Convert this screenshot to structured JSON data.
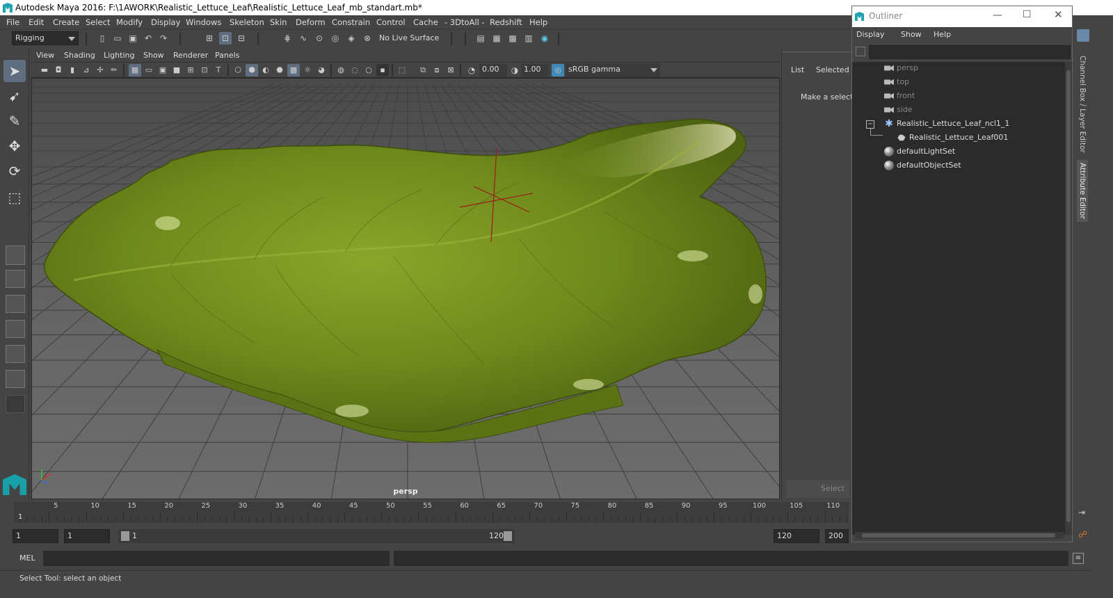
{
  "window": {
    "title": "Autodesk Maya 2016: F:\\1AWORK\\Realistic_Lettuce_Leaf\\Realistic_Lettuce_Leaf_mb_standart.mb*"
  },
  "menu": [
    "File",
    "Edit",
    "Create",
    "Select",
    "Modify",
    "Display",
    "Windows",
    "Skeleton",
    "Skin",
    "Deform",
    "Constrain",
    "Control",
    "Cache",
    "- 3DtoAll -",
    "Redshift",
    "Help"
  ],
  "shelf": {
    "mode": "Rigging",
    "live_surface": "No Live Surface"
  },
  "viewport": {
    "menu": [
      "View",
      "Shading",
      "Lighting",
      "Show",
      "Renderer",
      "Panels"
    ],
    "exposure": "0.00",
    "gamma": "1.00",
    "color_space": "sRGB gamma",
    "camera_label": "persp",
    "leaf_color": "#6f8a1c"
  },
  "channel_box": {
    "tabs": [
      "List",
      "Selected"
    ],
    "message": "Make a selecti",
    "select_btn": "Select"
  },
  "outliner": {
    "title": "Outliner",
    "menu": [
      "Display",
      "Show",
      "Help"
    ],
    "items": [
      {
        "label": "persp",
        "type": "camera"
      },
      {
        "label": "top",
        "type": "camera"
      },
      {
        "label": "front",
        "type": "camera"
      },
      {
        "label": "side",
        "type": "camera"
      },
      {
        "label": "Realistic_Lettuce_Leaf_ncl1_1",
        "type": "group"
      },
      {
        "label": "Realistic_Lettuce_Leaf001",
        "type": "mesh"
      },
      {
        "label": "defaultLightSet",
        "type": "set"
      },
      {
        "label": "defaultObjectSet",
        "type": "set"
      }
    ]
  },
  "side_tabs": [
    "Channel Box / Layer Editor",
    "Attribute Editor"
  ],
  "timeline": {
    "ticks": [
      "5",
      "10",
      "15",
      "20",
      "25",
      "30",
      "35",
      "40",
      "45",
      "50",
      "55",
      "60",
      "65",
      "70",
      "75",
      "80",
      "85",
      "90",
      "95",
      "100",
      "105",
      "110"
    ],
    "current": "1"
  },
  "range": {
    "start": "1",
    "current": "1",
    "slider_start": "1",
    "slider_end": "120",
    "end": "120",
    "max": "200"
  },
  "mel": {
    "label": "MEL"
  },
  "status": {
    "text": "Select Tool: select an object"
  }
}
